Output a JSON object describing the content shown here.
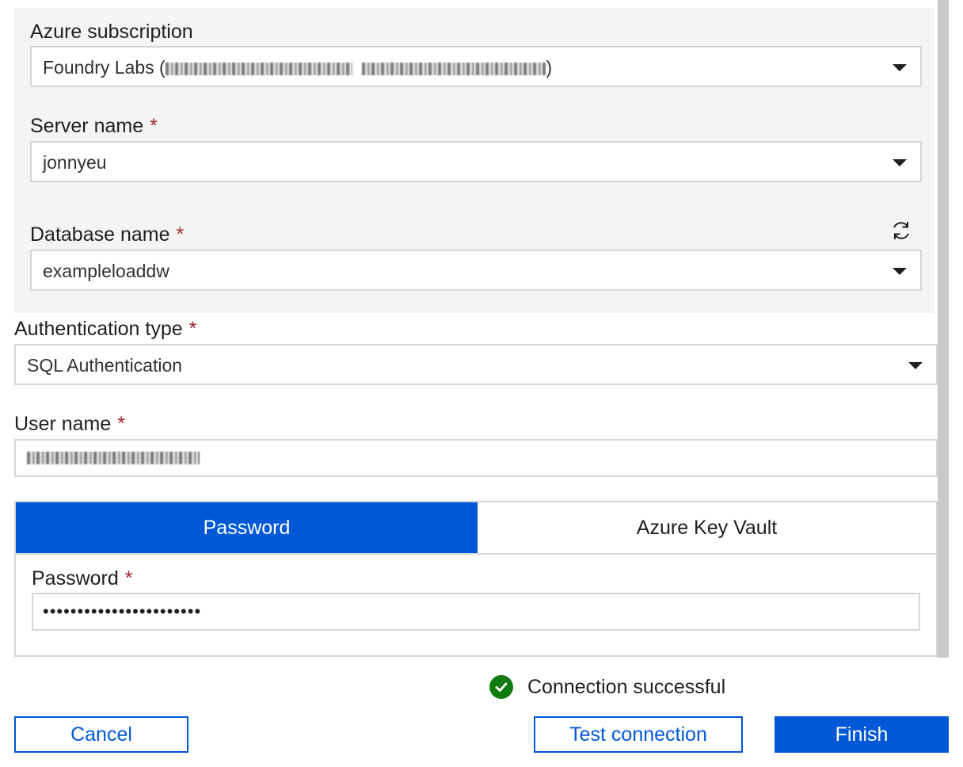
{
  "azure": {
    "subscription_label": "Azure subscription",
    "subscription_value_prefix": "Foundry Labs (",
    "subscription_value_suffix": ")",
    "server_label": "Server name",
    "server_value": "jonnyeu",
    "database_label": "Database name",
    "database_value": "exampleloaddw"
  },
  "required_marker": "*",
  "auth": {
    "type_label": "Authentication type",
    "type_value": "SQL Authentication",
    "username_label": "User name"
  },
  "tabs": {
    "password": "Password",
    "key_vault": "Azure Key Vault"
  },
  "password": {
    "label": "Password",
    "masked_value": "•••••••••••••••••••••••"
  },
  "status": {
    "text": "Connection successful",
    "color": "#107c10"
  },
  "buttons": {
    "cancel": "Cancel",
    "test": "Test connection",
    "finish": "Finish"
  },
  "colors": {
    "accent": "#0058d6",
    "required": "#a4262c"
  }
}
